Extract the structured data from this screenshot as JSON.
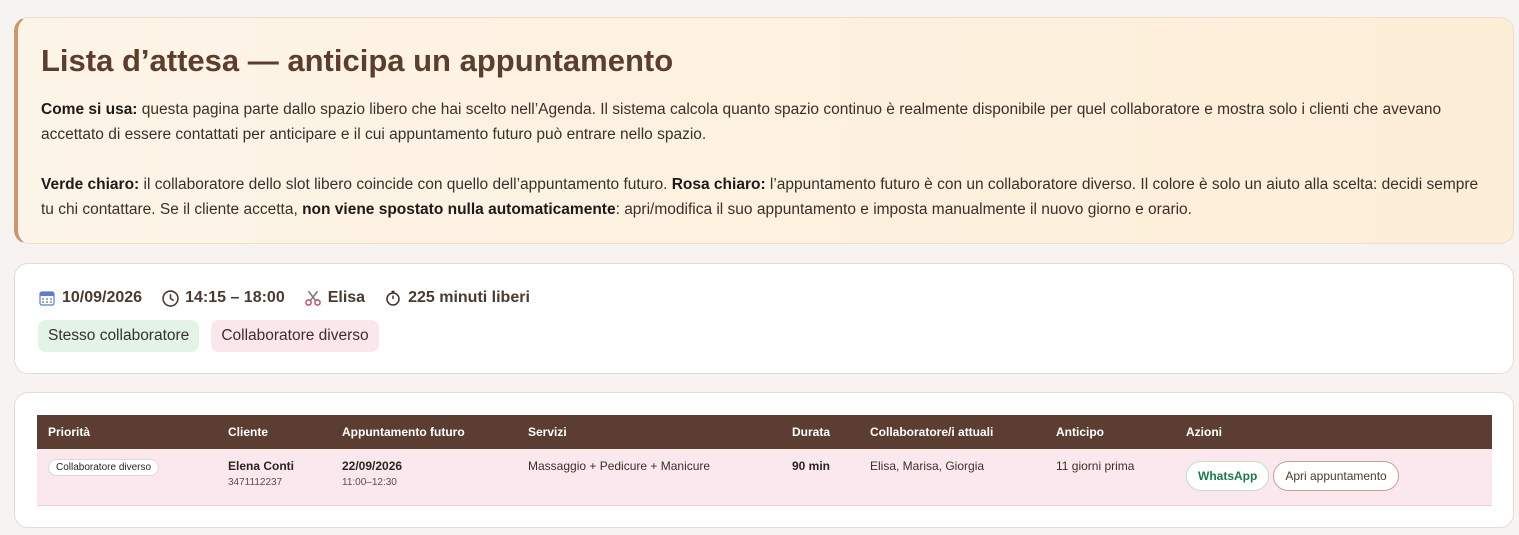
{
  "info": {
    "title": "Lista d’attesa — anticipa un appuntamento",
    "p1_label": "Come si usa:",
    "p1_text": " questa pagina parte dallo spazio libero che hai scelto nell’Agenda. Il sistema calcola quanto spazio continuo è realmente disponibile per quel collaboratore e mostra solo i clienti che avevano accettato di essere contattati per anticipare e il cui appuntamento futuro può entrare nello spazio.",
    "p2_label_a": "Verde chiaro:",
    "p2_text_a": " il collaboratore dello slot libero coincide con quello dell’appuntamento futuro. ",
    "p2_label_b": "Rosa chiaro:",
    "p2_text_b": " l’appuntamento futuro è con un collaboratore diverso. Il colore è solo un aiuto alla scelta: decidi sempre tu chi contattare. Se il cliente accetta, ",
    "p2_label_c": "non viene spostato nulla automaticamente",
    "p2_text_c": ": apri/modifica il suo appuntamento e imposta manualmente il nuovo giorno e orario."
  },
  "slot": {
    "date": "10/09/2026",
    "time": "14:15 – 18:00",
    "collaborator": "Elisa",
    "free": "225 minuti liberi",
    "icons": [
      "calendar-icon",
      "clock-icon",
      "scissors-icon",
      "stopwatch-icon"
    ]
  },
  "legend": {
    "same": "Stesso collaboratore",
    "different": "Collaboratore diverso"
  },
  "table": {
    "headers": [
      "Priorità",
      "Cliente",
      "Appuntamento futuro",
      "Servizi",
      "Durata",
      "Collaboratore/i attuali",
      "Anticipo",
      "Azioni"
    ],
    "rows": [
      {
        "priority": "Collaboratore diverso",
        "client_name": "Elena Conti",
        "client_phone": "3471112237",
        "future_date": "22/09/2026",
        "future_time": "11:00–12:30",
        "services": "Massaggio + Pedicure + Manicure",
        "duration": "90 min",
        "collaborators": "Elisa, Marisa, Giorgia",
        "advance": "11 giorni prima",
        "whatsapp_label": "WhatsApp",
        "open_label": "Apri appuntamento"
      }
    ]
  },
  "colors": {
    "header_bg": "#5c3d31",
    "same_bg": "#e3f3e6",
    "different_bg": "#fbe6ec",
    "whatsapp": "#1d7a4a"
  }
}
